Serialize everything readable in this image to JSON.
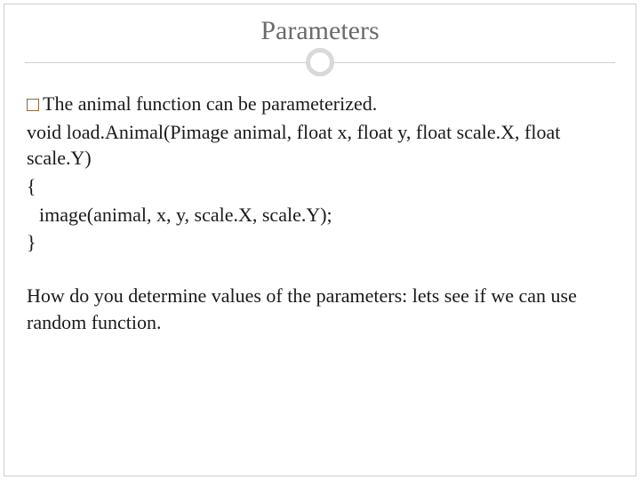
{
  "title": "Parameters",
  "bullet": "The animal function can be parameterized.",
  "code": {
    "line1": "void load.Animal(Pimage animal, float x, float y, float scale.X, float scale.Y)",
    "line2": "{",
    "line3": "image(animal, x, y, scale.X, scale.Y);",
    "line4": "}"
  },
  "closing": "How do you determine values of the parameters: lets see if we can use random function."
}
